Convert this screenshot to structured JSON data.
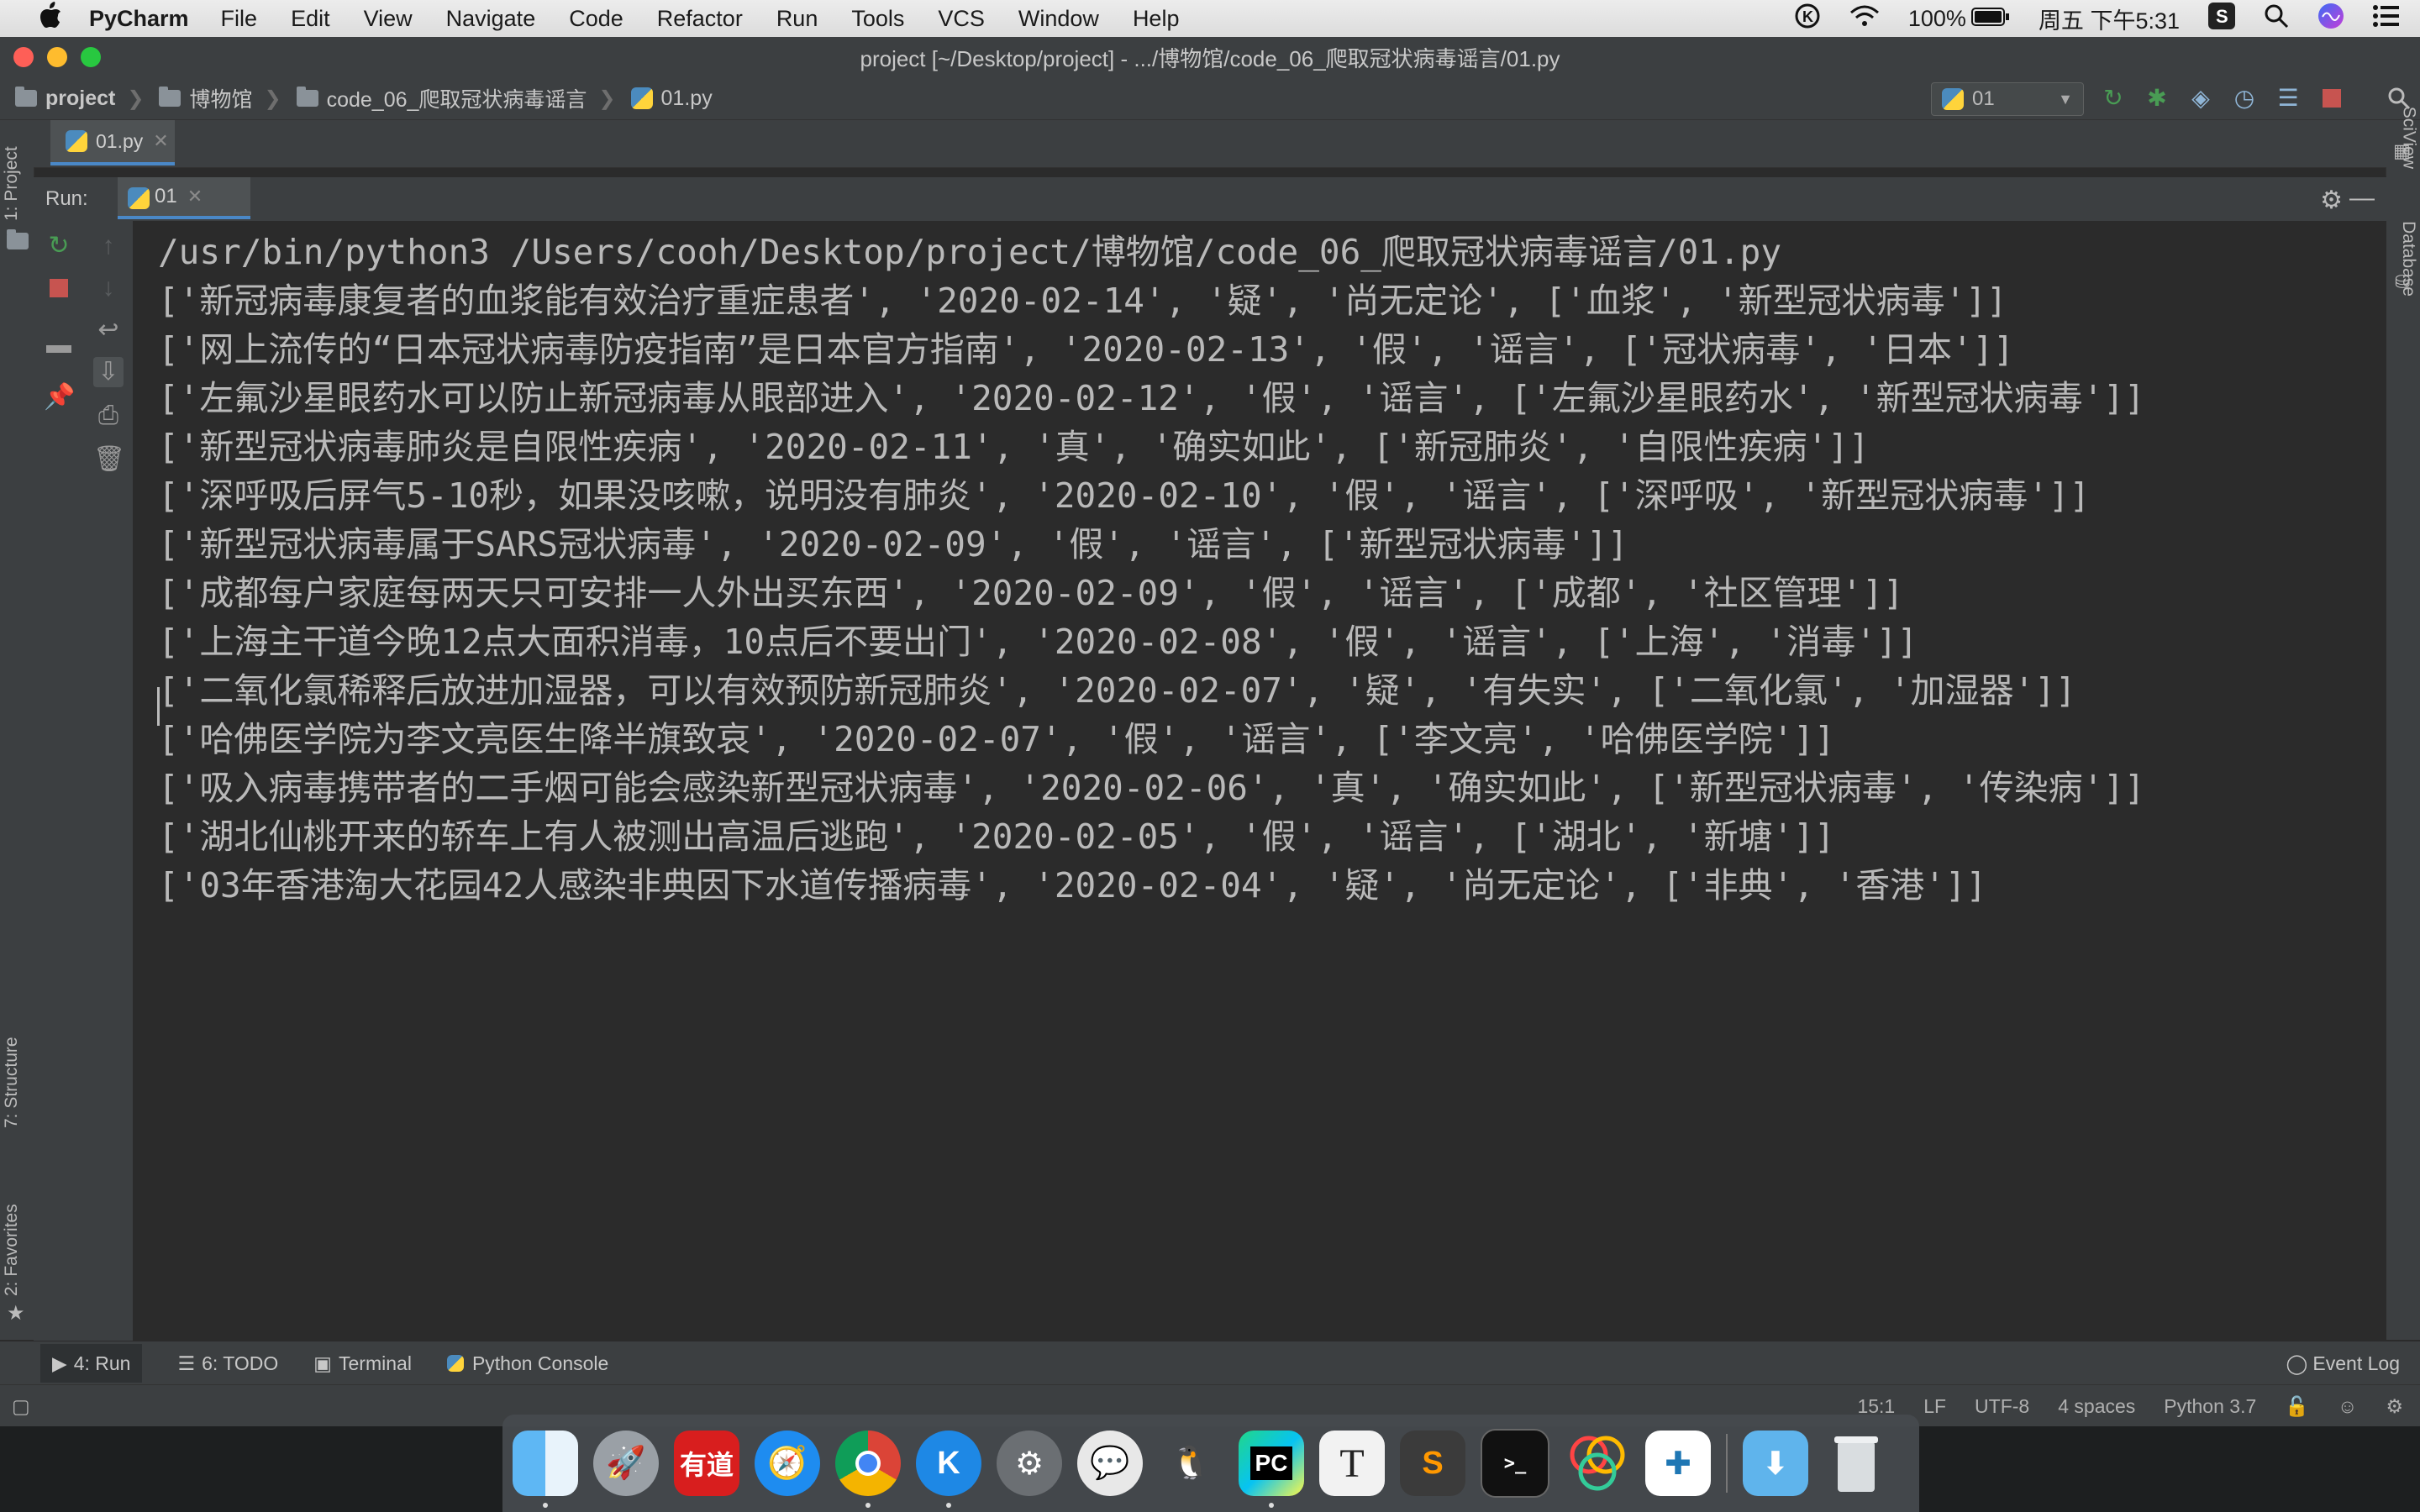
{
  "menubar": {
    "app_name": "PyCharm",
    "menus": [
      "File",
      "Edit",
      "View",
      "Navigate",
      "Code",
      "Refactor",
      "Run",
      "Tools",
      "VCS",
      "Window",
      "Help"
    ],
    "battery": "100%",
    "clock": "周五 下午5:31"
  },
  "window": {
    "title": "project [~/Desktop/project] - .../博物馆/code_06_爬取冠状病毒谣言/01.py"
  },
  "breadcrumb": {
    "items": [
      "project",
      "博物馆",
      "code_06_爬取冠状病毒谣言",
      "01.py"
    ],
    "run_config": "01"
  },
  "editor": {
    "tab_label": "01.py"
  },
  "run_panel": {
    "label": "Run:",
    "tab_label": "01"
  },
  "console": {
    "lines": [
      "/usr/bin/python3 /Users/cooh/Desktop/project/博物馆/code_06_爬取冠状病毒谣言/01.py",
      "['新冠病毒康复者的血浆能有效治疗重症患者', '2020-02-14', '疑', '尚无定论', ['血浆', '新型冠状病毒']]",
      "['网上流传的“日本冠状病毒防疫指南”是日本官方指南', '2020-02-13', '假', '谣言', ['冠状病毒', '日本']]",
      "['左氟沙星眼药水可以防止新冠病毒从眼部进入', '2020-02-12', '假', '谣言', ['左氟沙星眼药水', '新型冠状病毒']]",
      "['新型冠状病毒肺炎是自限性疾病', '2020-02-11', '真', '确实如此', ['新冠肺炎', '自限性疾病']]",
      "['深呼吸后屏气5-10秒，如果没咳嗽，说明没有肺炎', '2020-02-10', '假', '谣言', ['深呼吸', '新型冠状病毒']]",
      "['新型冠状病毒属于SARS冠状病毒', '2020-02-09', '假', '谣言', ['新型冠状病毒']]",
      "['成都每户家庭每两天只可安排一人外出买东西', '2020-02-09', '假', '谣言', ['成都', '社区管理']]",
      "['上海主干道今晚12点大面积消毒，10点后不要出门', '2020-02-08', '假', '谣言', ['上海', '消毒']]",
      "['二氧化氯稀释后放进加湿器，可以有效预防新冠肺炎', '2020-02-07', '疑', '有失实', ['二氧化氯', '加湿器']]",
      "['哈佛医学院为李文亮医生降半旗致哀', '2020-02-07', '假', '谣言', ['李文亮', '哈佛医学院']]",
      "['吸入病毒携带者的二手烟可能会感染新型冠状病毒', '2020-02-06', '真', '确实如此', ['新型冠状病毒', '传染病']]",
      "['湖北仙桃开来的轿车上有人被测出高温后逃跑', '2020-02-05', '假', '谣言', ['湖北', '新塘']]",
      "['03年香港淘大花园42人感染非典因下水道传播病毒', '2020-02-04', '疑', '尚无定论', ['非典', '香港']]"
    ]
  },
  "side_labels": {
    "project": "1: Project",
    "structure": "7: Structure",
    "favorites": "2: Favorites",
    "sciview": "SciView",
    "database": "Database"
  },
  "bottom_tabs": {
    "run": "4: Run",
    "todo": "6: TODO",
    "terminal": "Terminal",
    "python_console": "Python Console",
    "event_log": "Event Log"
  },
  "statusbar": {
    "position": "15:1",
    "line_sep": "LF",
    "encoding": "UTF-8",
    "indent": "4 spaces",
    "interpreter": "Python 3.7"
  },
  "dock": {
    "youdao_label": "有道",
    "pycharm_label": "PC",
    "typora_label": "T",
    "kuaibo_label": "K"
  },
  "colors": {
    "accent": "#4a88c7",
    "run_green": "#499c54",
    "stop_red": "#c75450",
    "console_bg": "#2b2b2b"
  }
}
